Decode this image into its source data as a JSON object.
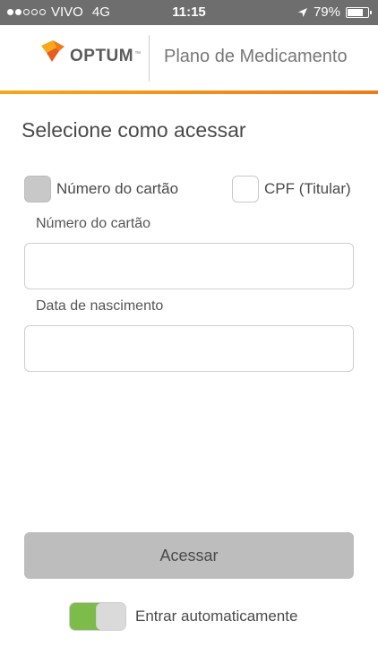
{
  "status_bar": {
    "carrier": "VIVO",
    "network": "4G",
    "time": "11:15",
    "battery_text": "79%",
    "battery_level": 0.79,
    "signal_bars_filled": 2,
    "signal_bars_total": 5
  },
  "header": {
    "logo_text": "OPTUM",
    "logo_tm": "™",
    "title": "Plano de Medicamento"
  },
  "colors": {
    "accent_orange": "#ee7a1c",
    "accent_yellow": "#f6a81b",
    "toggle_on": "#7dbb4a",
    "button_bg": "#bdbdbd"
  },
  "form": {
    "section_title": "Selecione como acessar",
    "options": [
      {
        "label": "Número do cartão",
        "checked": true
      },
      {
        "label": "CPF (Titular)",
        "checked": false
      }
    ],
    "card_number_label": "Número do cartão",
    "card_number_value": "",
    "birth_date_label": "Data de nascimento",
    "birth_date_value": "",
    "submit_label": "Acessar",
    "auto_login_label": "Entrar automaticamente",
    "auto_login_on": true
  }
}
